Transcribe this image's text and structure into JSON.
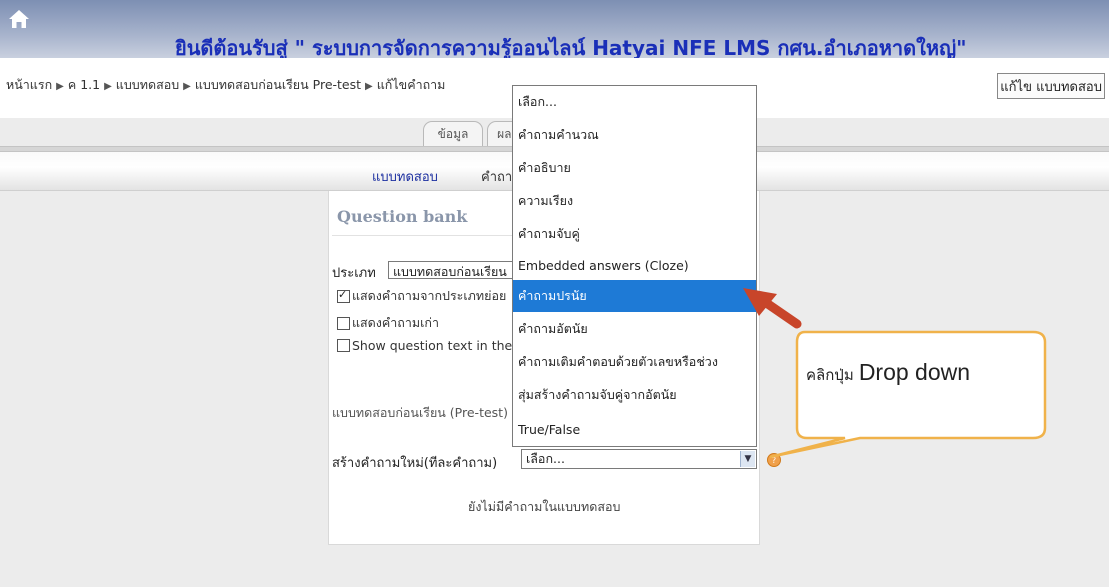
{
  "header": {
    "title": "ยินดีต้อนรับสู่ \" ระบบการจัดการความรู้ออนไลน์ Hatyai NFE LMS กศน.อำเภอหาดใหญ่\""
  },
  "breadcrumb": [
    "หน้าแรก",
    "ค 1.1",
    "แบบทดสอบ",
    "แบบทดสอบก่อนเรียน Pre-test",
    "แก้ไขคำถาม"
  ],
  "breadcrumb_separator": "▶",
  "edit_quiz_button": "แก้ไข แบบทดสอบ",
  "tabs": [
    "ข้อมูล",
    "ผลล"
  ],
  "subtabs": [
    "แบบทดสอบ",
    "คำถาม"
  ],
  "panel": {
    "title": "Question bank",
    "category_label": "ประเภท",
    "category_value": "แบบทดสอบก่อนเรียน",
    "checkboxes": [
      {
        "label": "แสดงคำถามจากประเภทย่อย",
        "checked": true
      },
      {
        "label": "แสดงคำถามเก่า",
        "checked": false
      },
      {
        "label": "Show question text in the",
        "checked": false
      }
    ],
    "info": "แบบทดสอบก่อนเรียน (Pre-test)",
    "create_label": "สร้างคำถามใหม่(ทีละคำถาม)",
    "create_value": "เลือก...",
    "empty_message": "ยังไม่มีคำถามในแบบทดสอบ"
  },
  "dropdown": {
    "options": [
      "เลือก...",
      "คำถามคำนวณ",
      "คำอธิบาย",
      "ความเรียง",
      "คำถามจับคู่",
      "Embedded answers (Cloze)",
      "คำถามปรนัย",
      "คำถามอัตนัย",
      "คำถามเติมคำตอบด้วยตัวเลขหรือช่วง",
      "สุ่มสร้างคำถามจับคู่จากอัตนัย",
      "True/False"
    ],
    "selected_index": 6
  },
  "callout": {
    "text_thai": "คลิกปุ่ม",
    "text_en": "Drop down",
    "border_color": "#f0b24a",
    "fill_color": "#ffffff"
  },
  "arrow_color": "#c8452a",
  "colors": {
    "title": "#1a2fb8",
    "selected": "#1e7ad6"
  }
}
